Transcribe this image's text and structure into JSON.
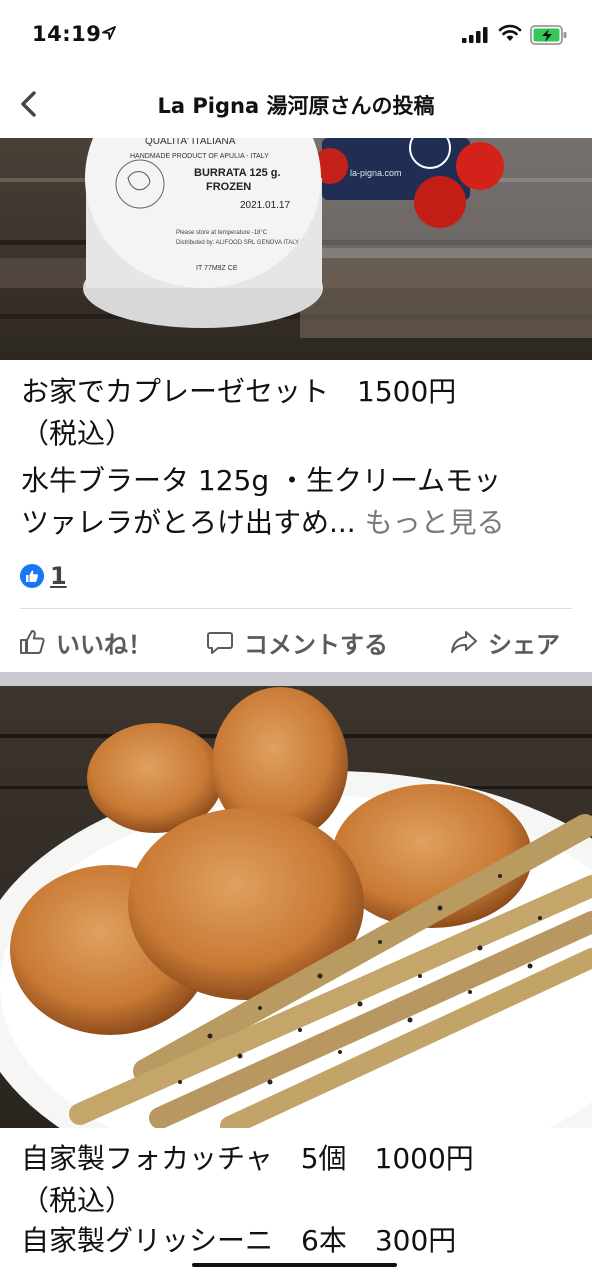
{
  "status_bar": {
    "time": "14:19"
  },
  "nav": {
    "title": "La Pigna 湯河原さんの投稿"
  },
  "post1": {
    "line1": "お家でカプレーゼセット　1500円",
    "line2": "（税込）",
    "line3": "水牛ブラータ 125g ・生クリームモッ",
    "line4": "ツァレラがとろけ出すめ...",
    "see_more": "もっと見る",
    "photo_labels": {
      "brand": "QUALITA' ITALIANA",
      "sub": "HANDMADE PRODUCT OF APULIA - ITALY",
      "product": "BURRATA 125 g.",
      "frozen": "FROZEN",
      "expiry": "2021.01.17",
      "site": "la-pigna.com"
    }
  },
  "reactions": {
    "count": "1"
  },
  "actions": {
    "like": "いいね！",
    "comment": "コメントする",
    "share": "シェア"
  },
  "post2": {
    "line1": "自家製フォカッチャ　5個　1000円",
    "line2": "（税込）",
    "line3": "自家製グリッシーニ　6本　300円"
  },
  "colors": {
    "like_blue": "#1877f2",
    "separator": "#c9cbd1"
  }
}
